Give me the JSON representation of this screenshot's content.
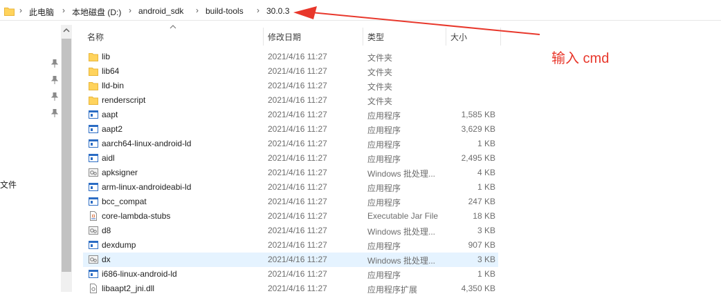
{
  "breadcrumb": [
    "此电脑",
    "本地磁盘 (D:)",
    "android_sdk",
    "build-tools",
    "30.0.3"
  ],
  "nav": {
    "partial_label": "文件"
  },
  "columns": {
    "name": "名称",
    "date": "修改日期",
    "type": "类型",
    "size": "大小"
  },
  "files": [
    {
      "name": "lib",
      "date": "2021/4/16 11:27",
      "type": "文件夹",
      "size": "",
      "icon": "folder-icon"
    },
    {
      "name": "lib64",
      "date": "2021/4/16 11:27",
      "type": "文件夹",
      "size": "",
      "icon": "folder-icon"
    },
    {
      "name": "lld-bin",
      "date": "2021/4/16 11:27",
      "type": "文件夹",
      "size": "",
      "icon": "folder-icon"
    },
    {
      "name": "renderscript",
      "date": "2021/4/16 11:27",
      "type": "文件夹",
      "size": "",
      "icon": "folder-icon"
    },
    {
      "name": "aapt",
      "date": "2021/4/16 11:27",
      "type": "应用程序",
      "size": "1,585 KB",
      "icon": "exe-icon"
    },
    {
      "name": "aapt2",
      "date": "2021/4/16 11:27",
      "type": "应用程序",
      "size": "3,629 KB",
      "icon": "exe-icon"
    },
    {
      "name": "aarch64-linux-android-ld",
      "date": "2021/4/16 11:27",
      "type": "应用程序",
      "size": "1 KB",
      "icon": "exe-icon"
    },
    {
      "name": "aidl",
      "date": "2021/4/16 11:27",
      "type": "应用程序",
      "size": "2,495 KB",
      "icon": "exe-icon"
    },
    {
      "name": "apksigner",
      "date": "2021/4/16 11:27",
      "type": "Windows 批处理...",
      "size": "4 KB",
      "icon": "batch-icon"
    },
    {
      "name": "arm-linux-androideabi-ld",
      "date": "2021/4/16 11:27",
      "type": "应用程序",
      "size": "1 KB",
      "icon": "exe-icon"
    },
    {
      "name": "bcc_compat",
      "date": "2021/4/16 11:27",
      "type": "应用程序",
      "size": "247 KB",
      "icon": "exe-icon"
    },
    {
      "name": "core-lambda-stubs",
      "date": "2021/4/16 11:27",
      "type": "Executable Jar File",
      "size": "18 KB",
      "icon": "jar-icon"
    },
    {
      "name": "d8",
      "date": "2021/4/16 11:27",
      "type": "Windows 批处理...",
      "size": "3 KB",
      "icon": "batch-icon"
    },
    {
      "name": "dexdump",
      "date": "2021/4/16 11:27",
      "type": "应用程序",
      "size": "907 KB",
      "icon": "exe-icon"
    },
    {
      "name": "dx",
      "date": "2021/4/16 11:27",
      "type": "Windows 批处理...",
      "size": "3 KB",
      "icon": "batch-icon",
      "selected": true
    },
    {
      "name": "i686-linux-android-ld",
      "date": "2021/4/16 11:27",
      "type": "应用程序",
      "size": "1 KB",
      "icon": "exe-icon"
    },
    {
      "name": "libaapt2_jni.dll",
      "date": "2021/4/16 11:27",
      "type": "应用程序扩展",
      "size": "4,350 KB",
      "icon": "dll-icon"
    }
  ],
  "annotation": {
    "text": "输入 cmd",
    "color": "#e8372b"
  },
  "colors": {
    "folder": "#ffd35c",
    "folder_dark": "#e8b53a",
    "selection": "#e5f3ff",
    "exe_blue": "#2b6cc4"
  }
}
